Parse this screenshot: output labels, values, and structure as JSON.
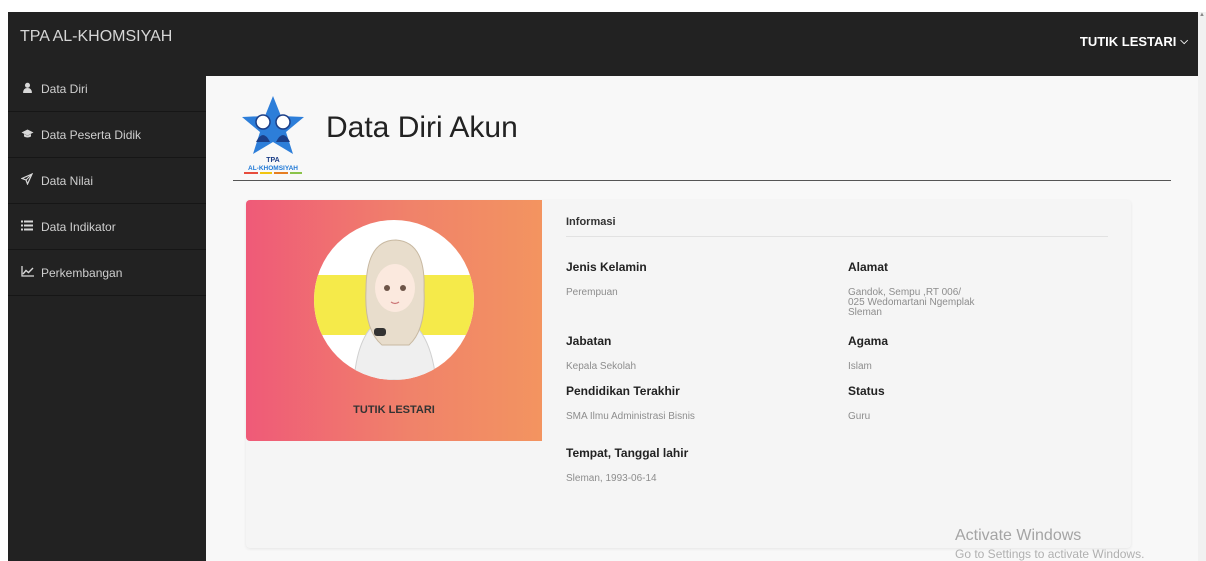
{
  "app": {
    "brand": "TPA AL-KHOMSIYAH",
    "user": "TUTIK LESTARI"
  },
  "sidebar": {
    "items": [
      {
        "label": "Data Diri",
        "icon": "user-icon"
      },
      {
        "label": "Data Peserta Didik",
        "icon": "graduation-cap-icon"
      },
      {
        "label": "Data Nilai",
        "icon": "paper-plane-icon"
      },
      {
        "label": "Data Indikator",
        "icon": "list-icon"
      },
      {
        "label": "Perkembangan",
        "icon": "line-chart-icon"
      }
    ]
  },
  "page": {
    "title": "Data Diri Akun",
    "logo": {
      "line1": "TPA",
      "line2": "AL-KHOMSIYAH",
      "icon": "star-children-logo"
    }
  },
  "profile": {
    "name": "TUTIK LESTARI"
  },
  "info": {
    "title": "Informasi",
    "jenis_kelamin": {
      "label": "Jenis Kelamin",
      "value": "Perempuan"
    },
    "alamat": {
      "label": "Alamat",
      "value": "Gandok, Sempu ,RT 006/ 025 Wedomartani Ngemplak Sleman"
    },
    "jabatan": {
      "label": "Jabatan",
      "value": "Kepala Sekolah"
    },
    "agama": {
      "label": "Agama",
      "value": "Islam"
    },
    "pendidikan": {
      "label": "Pendidikan Terakhir",
      "value": "SMA Ilmu Administrasi Bisnis"
    },
    "status": {
      "label": "Status",
      "value": "Guru"
    },
    "ttl": {
      "label": "Tempat, Tanggal lahir",
      "value": "Sleman, 1993-06-14"
    }
  },
  "watermark": {
    "line1": "Activate Windows",
    "line2": "Go to Settings to activate Windows."
  },
  "colors": {
    "bar": "#222222",
    "gradient_start": "#ef5a78",
    "gradient_end": "#f39460",
    "avatar_bg": "#f5ea4a"
  }
}
